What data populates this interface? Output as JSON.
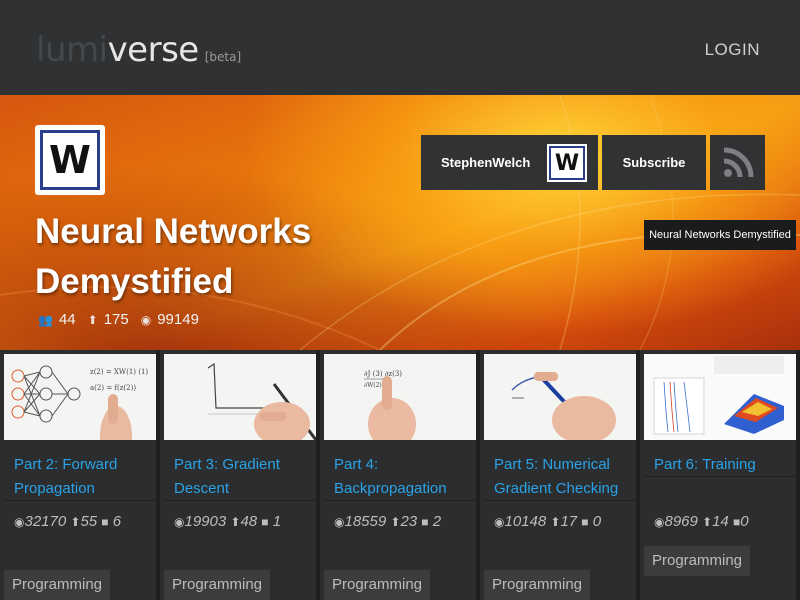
{
  "header": {
    "logo_lumi": "lumi",
    "logo_verse": "verse",
    "beta": "[beta]",
    "login": "LOGIN"
  },
  "hero": {
    "channel_initial": "W",
    "title": "Neural Networks Demystified",
    "stats": {
      "followers": "44",
      "upvotes": "175",
      "views": "99149"
    },
    "user_label": "StephenWelch",
    "subscribe_label": "Subscribe"
  },
  "cards": [
    {
      "title": "Part 2: Forward Propagation",
      "views": "32170",
      "upvotes": "55",
      "comments": "6",
      "tag": "Programming"
    },
    {
      "title": "Part 3: Gradient Descent",
      "views": "19903",
      "upvotes": "48",
      "comments": "1",
      "tag": "Programming"
    },
    {
      "title": "Part 4: Backpropagation",
      "views": "18559",
      "upvotes": "23",
      "comments": "2",
      "tag": "Programming"
    },
    {
      "title": "Part 5: Numerical Gradient Checking",
      "views": "10148",
      "upvotes": "17",
      "comments": "0",
      "tag": "Programming"
    },
    {
      "title": "Part 6: Training",
      "views": "8969",
      "upvotes": "14",
      "comments": "0",
      "tag": "Programming"
    }
  ],
  "overlay_caption": "Neural Networks Demystified",
  "colors": {
    "accent_link": "#2aa3e8",
    "topbar": "#2f3133",
    "card_bg": "#2b2d2f"
  }
}
